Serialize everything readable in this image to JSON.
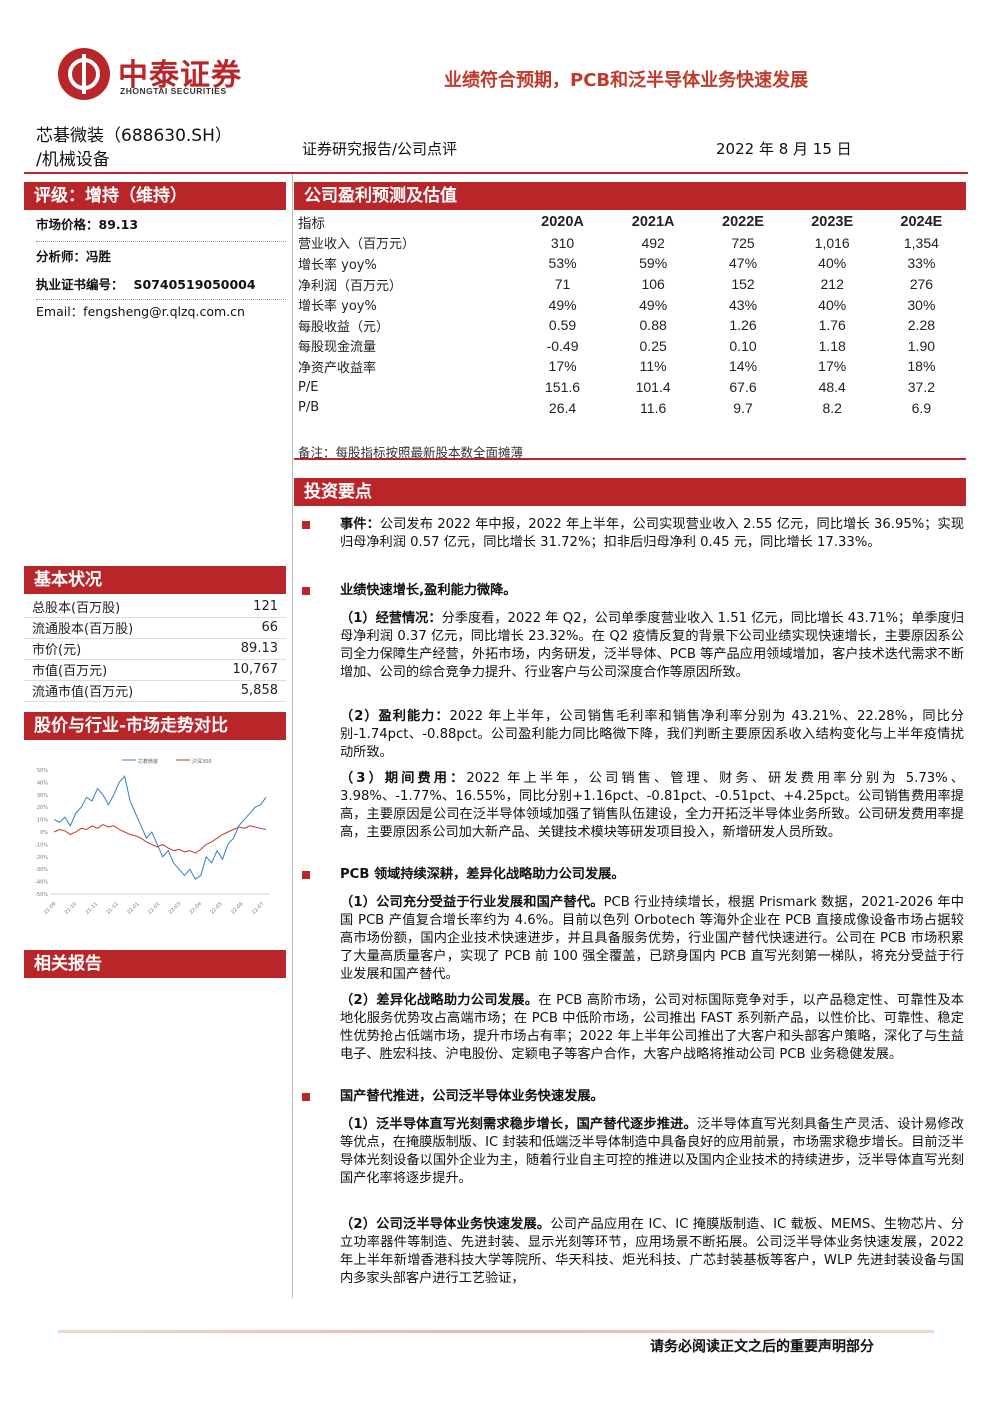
{
  "brand": {
    "name_cn": "中泰证券",
    "name_en": "ZHONGTAI SECURITIES"
  },
  "headline": "业绩符合预期，PCB和泛半导体业务快速发展",
  "stock": {
    "line1": "芯碁微装（688630.SH）",
    "line2": "/机械设备"
  },
  "report_type": "证券研究报告/公司点评",
  "report_date": "2022 年 8 月 15 日",
  "rating": {
    "label": "评级：增持（维持）",
    "price_label": "市场价格：89.13"
  },
  "analyst": {
    "name_label": "分析师：冯胜",
    "cert_label": "执业证书编号：",
    "cert_no": "S0740519050004",
    "email": "Email：fengsheng@r.qlzq.com.cn"
  },
  "sections": {
    "forecast": "公司盈利预测及估值",
    "invest": "投资要点",
    "basic": "基本状况",
    "trend": "股价与行业-市场走势对比",
    "related": "相关报告"
  },
  "forecast": {
    "headers": [
      "指标",
      "2020A",
      "2021A",
      "2022E",
      "2023E",
      "2024E"
    ],
    "rows": [
      [
        "营业收入（百万元）",
        "310",
        "492",
        "725",
        "1,016",
        "1,354"
      ],
      [
        "增长率 yoy%",
        "53%",
        "59%",
        "47%",
        "40%",
        "33%"
      ],
      [
        "净利润（百万元）",
        "71",
        "106",
        "152",
        "212",
        "276"
      ],
      [
        "增长率 yoy%",
        "49%",
        "49%",
        "43%",
        "40%",
        "30%"
      ],
      [
        "每股收益（元）",
        "0.59",
        "0.88",
        "1.26",
        "1.76",
        "2.28"
      ],
      [
        "每股现金流量",
        "-0.49",
        "0.25",
        "0.10",
        "1.18",
        "1.90"
      ],
      [
        "净资产收益率",
        "17%",
        "11%",
        "14%",
        "17%",
        "18%"
      ],
      [
        "P/E",
        "151.6",
        "101.4",
        "67.6",
        "48.4",
        "37.2"
      ],
      [
        "P/B",
        "26.4",
        "11.6",
        "9.7",
        "8.2",
        "6.9"
      ]
    ],
    "note": "备注：每股指标按照最新股本数全面摊薄"
  },
  "basic": [
    [
      "总股本(百万股)",
      "121"
    ],
    [
      "流通股本(百万股)",
      "66"
    ],
    [
      "市价(元)",
      "89.13"
    ],
    [
      "市值(百万元)",
      "10,767"
    ],
    [
      "流通市值(百万元)",
      "5,858"
    ]
  ],
  "chart": {
    "legend": [
      "芯碁微装",
      "沪深300"
    ],
    "yticks": [
      "50%",
      "40%",
      "30%",
      "20%",
      "10%",
      "0%",
      "-10%",
      "-20%",
      "-30%",
      "-40%",
      "-50%"
    ],
    "xticks": [
      "21-09",
      "21-10",
      "21-11",
      "21-12",
      "22-01",
      "22-02",
      "22-03",
      "22-04",
      "22-05",
      "22-06",
      "22-07"
    ]
  },
  "body": {
    "b1_bold": "事件：",
    "b1_text": "公司发布 2022 年中报，2022 年上半年，公司实现营业收入 2.55 亿元，同比增长 36.95%；实现归母净利润 0.57 亿元，同比增长 31.72%；扣非后归母净利 0.45 元，同比增长 17.33%。",
    "b2": "业绩快速增长,盈利能力微降。",
    "p1_bold": "（1）经营情况：",
    "p1_text": "分季度看，2022 年 Q2，公司单季度营业收入 1.51 亿元，同比增长 43.71%；单季度归母净利润 0.37 亿元，同比增长 23.32%。在 Q2 疫情反复的背景下公司业绩实现快速增长，主要原因系公司全力保障生产经营，外拓市场，内务研发，泛半导体、PCB 等产品应用领域增加，客户技术迭代需求不断增加、公司的综合竞争力提升、行业客户与公司深度合作等原因所致。",
    "p2_bold": "（2）盈利能力：",
    "p2_text": "2022 年上半年，公司销售毛利率和销售净利率分别为 43.21%、22.28%，同比分别-1.74pct、-0.88pct。公司盈利能力同比略微下降，我们判断主要原因系收入结构变化与上半年疫情扰动所致。",
    "p3_bold": "（3）期间费用：",
    "p3_text": "2022 年上半年，公司销售、管理、财务、研发费用率分别为 5.73%、3.98%、-1.77%、16.55%，同比分别+1.16pct、-0.81pct、-0.51pct、+4.25pct。公司销售费用率提高，主要原因是公司在泛半导体领域加强了销售队伍建设，全力开拓泛半导体业务所致。公司研发费用率提高，主要原因系公司加大新产品、关键技术模块等研发项目投入，新增研发人员所致。",
    "b3": "PCB 领域持续深耕，差异化战略助力公司发展。",
    "p4_bold": "（1）公司充分受益于行业发展和国产替代。",
    "p4_text": "PCB 行业持续增长，根据 Prismark 数据，2021-2026 年中国 PCB 产值复合增长率约为 4.6%。目前以色列 Orbotech 等海外企业在 PCB 直接成像设备市场占据较高市场份额，国内企业技术快速进步，并且具备服务优势，行业国产替代快速进行。公司在 PCB 市场积累了大量高质量客户，实现了 PCB 前 100 强全覆盖，已跻身国内 PCB 直写光刻第一梯队，将充分受益于行业发展和国产替代。",
    "p5_bold": "（2）差异化战略助力公司发展。",
    "p5_text": "在 PCB 高阶市场，公司对标国际竞争对手，以产品稳定性、可靠性及本地化服务优势攻占高端市场；在 PCB 中低阶市场，公司推出 FAST 系列新产品，以性价比、可靠性、稳定性优势抢占低端市场，提升市场占有率；2022 年上半年公司推出了大客户和头部客户策略，深化了与生益电子、胜宏科技、沪电股份、定颖电子等客户合作，大客户战略将推动公司 PCB 业务稳健发展。",
    "b4": "国产替代推进，公司泛半导体业务快速发展。",
    "p6_bold": "（1）泛半导体直写光刻需求稳步增长，国产替代逐步推进。",
    "p6_text": "泛半导体直写光刻具备生产灵活、设计易修改等优点，在掩膜版制版、IC 封装和低端泛半导体制造中具备良好的应用前景，市场需求稳步增长。目前泛半导体光刻设备以国外企业为主，随着行业自主可控的推进以及国内企业技术的持续进步，泛半导体直写光刻国产化率将逐步提升。",
    "p7_bold": "（2）公司泛半导体业务快速发展。",
    "p7_text": "公司产品应用在 IC、IC 掩膜版制造、IC 载板、MEMS、生物芯片、分立功率器件等制造、先进封装、显示光刻等环节，应用场景不断拓展。公司泛半导体业务快速发展，2022 年上半年新增香港科技大学等院所、华天科技、炬光科技、广芯封装基板等客户，WLP 先进封装设备与国内多家头部客户进行工艺验证，"
  },
  "footer": "请务必阅读正文之后的重要声明部分",
  "colors": {
    "brand_red": "#b8262a",
    "headline_red": "#c0392b",
    "series_stock": "#3a7cc8",
    "series_index": "#c0392b"
  }
}
